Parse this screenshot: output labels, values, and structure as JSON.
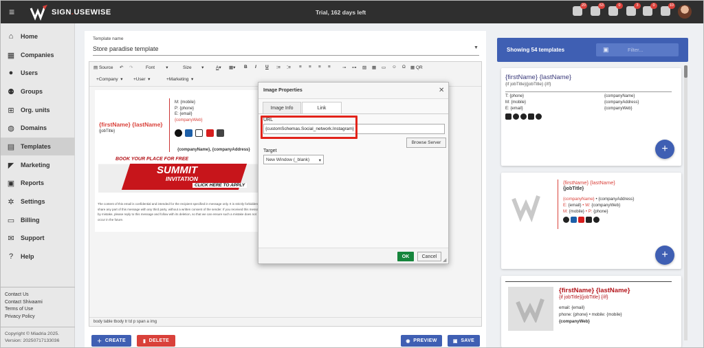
{
  "topbar": {
    "brand_a": "SIGN",
    "brand_sep": ".",
    "brand_b": "USEWISE",
    "trial": "Trial, 162 days left",
    "badges": [
      "20",
      "53",
      "0",
      "3",
      "0",
      "10"
    ],
    "icons": [
      "users-icon",
      "mail-icon",
      "groups-icon",
      "org-icon",
      "globe-icon",
      "logout-icon"
    ]
  },
  "sidebar": {
    "items": [
      {
        "label": "Home",
        "icon": "⌂"
      },
      {
        "label": "Companies",
        "icon": "▦"
      },
      {
        "label": "Users",
        "icon": "●"
      },
      {
        "label": "Groups",
        "icon": "⚉"
      },
      {
        "label": "Org. units",
        "icon": "⊞"
      },
      {
        "label": "Domains",
        "icon": "◍"
      },
      {
        "label": "Templates",
        "icon": "▤"
      },
      {
        "label": "Marketing",
        "icon": "◤"
      },
      {
        "label": "Reports",
        "icon": "▣"
      },
      {
        "label": "Settings",
        "icon": "✲"
      },
      {
        "label": "Billing",
        "icon": "▭"
      },
      {
        "label": "Support",
        "icon": "✉"
      },
      {
        "label": "Help",
        "icon": "?"
      }
    ],
    "links": [
      "Contact Us",
      "Contact Shivaami",
      "Terms of Use",
      "Privacy Policy"
    ],
    "copyright": "Copyright © Miadria 2025.",
    "version": "Version: 20250717133036"
  },
  "editor": {
    "name_label": "Template name",
    "name_value": "Store paradise template",
    "toolbar": {
      "source": "Source",
      "font": "Font",
      "size": "Size",
      "company": "+Company",
      "user": "+User",
      "marketing": "+Marketing",
      "qr": "QR"
    },
    "sig": {
      "name": "{firstName} {lastName}",
      "jobtitle": "{jobTitle}",
      "mobile": "M: {mobile}",
      "phone": "P: {phone}",
      "email": "E: {email}",
      "web": "{companyWeb}",
      "company": "{companyName}, {companyAddress}",
      "banner_a": "BOOK YOUR PLACE FOR FREE",
      "banner_b": "SUMMIT",
      "banner_c": "INVITATION",
      "banner_d": "CLICK HERE TO APPLY",
      "disclaimer": "The content of this email is confidential and intended for the recipient specified in message only. It is strictly forbidden to share any part of this message with any third party, without a written consent of the sender. If you received this message by mistake, please reply to this message and follow with its deletion, so that we can ensure such a mistake does not occur in the future."
    },
    "status_path": "body  table  tbody  tr  td  p  span  a  img"
  },
  "buttons": {
    "create": "CREATE",
    "delete": "DELETE",
    "preview": "PREVIEW",
    "save": "SAVE"
  },
  "dialog": {
    "title": "Image Properties",
    "tab_info": "Image Info",
    "tab_link": "Link",
    "url_label": "URL",
    "url_value": "{customSchemas.Social_network.Instagram}",
    "browse": "Browse Server",
    "target_label": "Target",
    "target_value": "New Window (_blank)",
    "ok": "OK",
    "cancel": "Cancel"
  },
  "right": {
    "showing": "Showing 54 templates",
    "filter_placeholder": "Filter...",
    "card1": {
      "name": "{firstName} {lastName}",
      "jobtitle": "{if jobTitle}{jobTitle} {/if}",
      "t": "T: {phone}",
      "m": "M: {mobile}",
      "e": "E: {email}",
      "cname": "{companyName}",
      "caddr": "{companyAddress}",
      "cweb": "{companyWeb}"
    },
    "card2": {
      "name": "{firstName} {lastName}",
      "jobtitle": "{jobTitle}",
      "line1a": "{companyName}",
      "line1b": " • {companyAddress}",
      "line2a": "E: ",
      "line2b": "{email}",
      "line2c": " • W: ",
      "line2d": "{companyWeb}",
      "line3a": "M: ",
      "line3b": "{mobile}",
      "line3c": " • P: ",
      "line3d": "{phone}"
    },
    "card3": {
      "name": "{firstName} {lastName}",
      "jobtitle": "{if jobTitle}{jobTitle} {/if}",
      "email": "email: {email}",
      "phone": "phone: {phone} • mobile: {mobile}",
      "web": "{companyWeb}"
    }
  }
}
